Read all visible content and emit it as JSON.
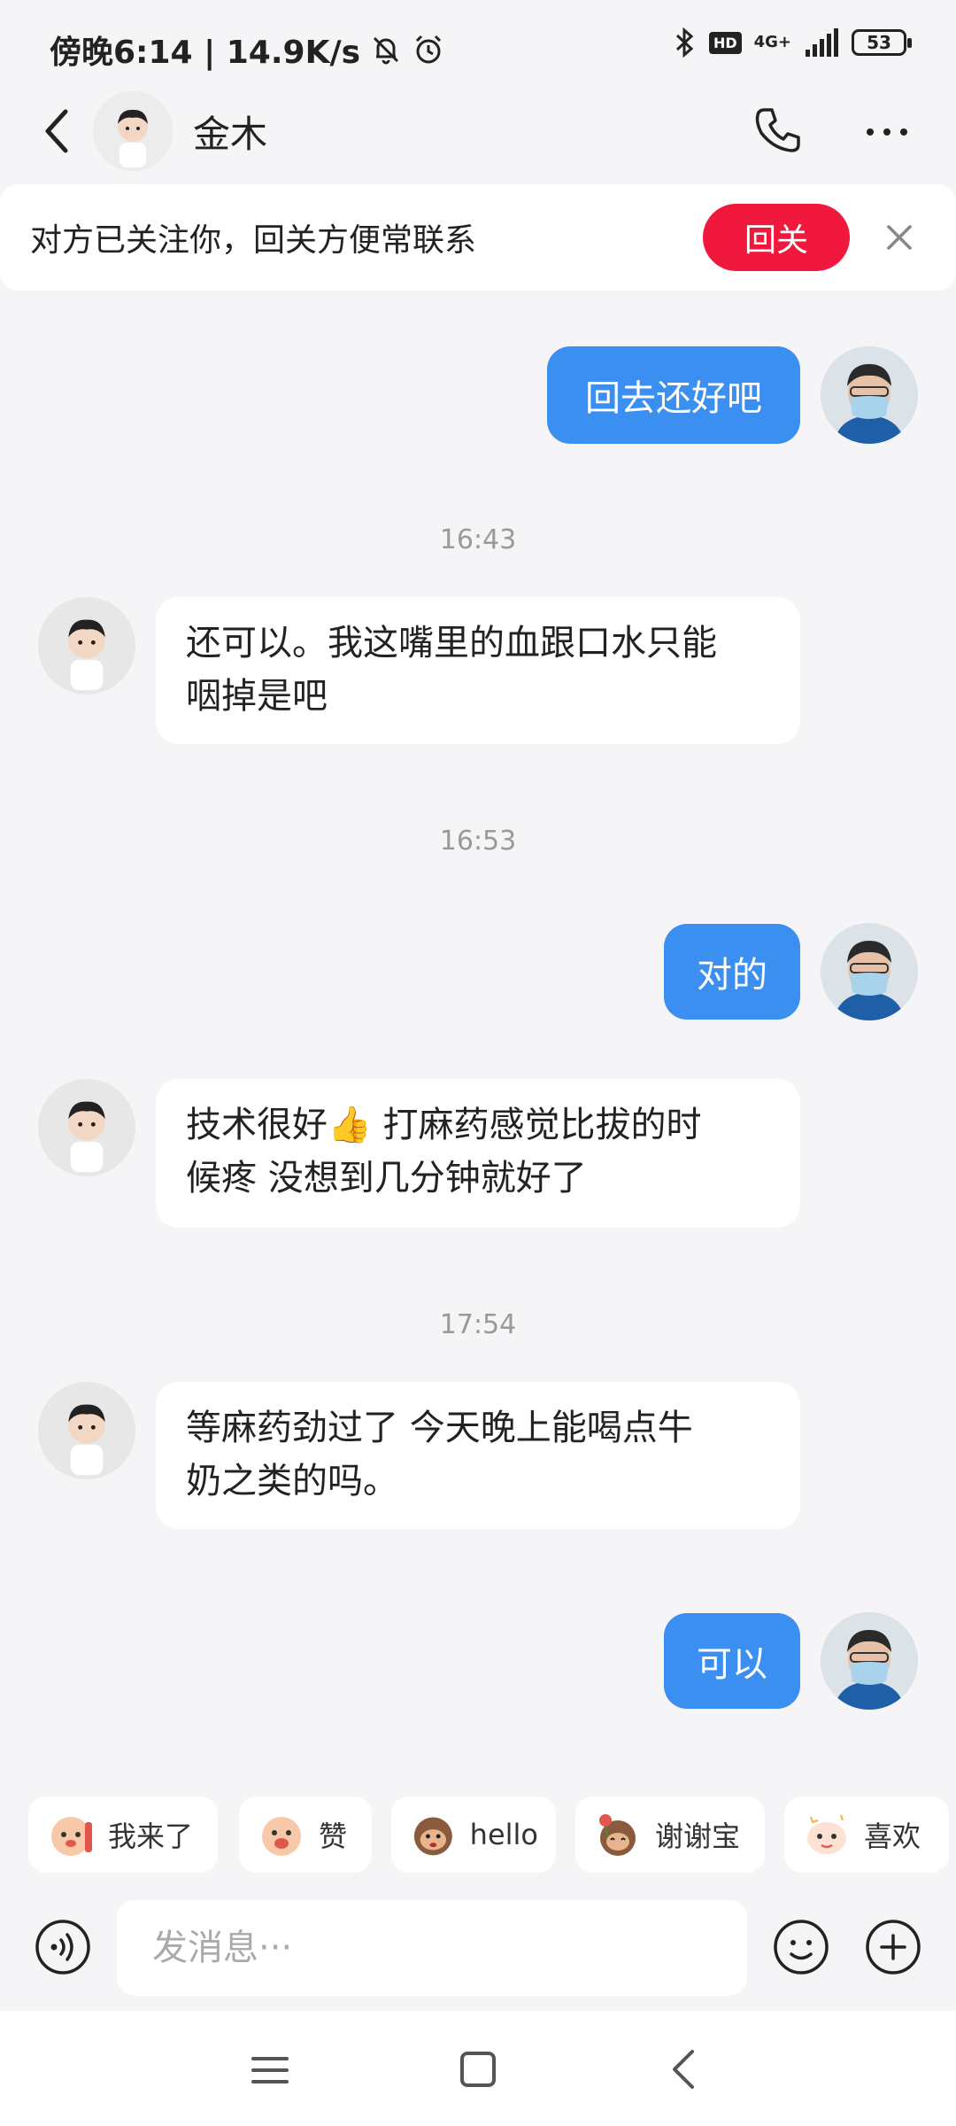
{
  "status_bar": {
    "left_text": "傍晚6:14 | 14.9K/s",
    "hd": "HD",
    "network": "4G+",
    "battery": "53"
  },
  "header": {
    "contact_name": "金木",
    "icons": [
      "back-icon",
      "phone-icon",
      "more-icon"
    ]
  },
  "banner": {
    "text": "对方已关注你，回关方便常联系",
    "button_label": "回关",
    "close_icon": "close-icon"
  },
  "messages": [
    {
      "from": "me",
      "text": "回去还好吧"
    },
    {
      "timestamp": "16:43"
    },
    {
      "from": "contact",
      "lines": [
        "还可以。我这嘴里的血跟口水只能",
        "咽掉是吧"
      ]
    },
    {
      "timestamp": "16:53"
    },
    {
      "from": "me",
      "text": "对的"
    },
    {
      "from": "contact",
      "lines": [
        "技术很好👍 打麻药感觉比拔的时",
        "候疼 没想到几分钟就好了"
      ]
    },
    {
      "timestamp": "17:54"
    },
    {
      "from": "contact",
      "lines": [
        "等麻药劲过了 今天晚上能喝点牛",
        "奶之类的吗。"
      ]
    },
    {
      "from": "me",
      "text": "可以"
    }
  ],
  "quick_replies": [
    {
      "label": "我来了",
      "icon": "sticker-icon"
    },
    {
      "label": "赞",
      "icon": "sticker-icon"
    },
    {
      "label": "hello",
      "icon": "monkey-sticker-icon"
    },
    {
      "label": "谢谢宝",
      "icon": "monkey-sticker-icon"
    },
    {
      "label": "喜欢",
      "icon": "sticker-icon"
    }
  ],
  "composer": {
    "placeholder": "发消息···"
  },
  "colors": {
    "accent": "#3a8ff1",
    "follow_button": "#f0183c",
    "background": "#f5f5f7"
  }
}
